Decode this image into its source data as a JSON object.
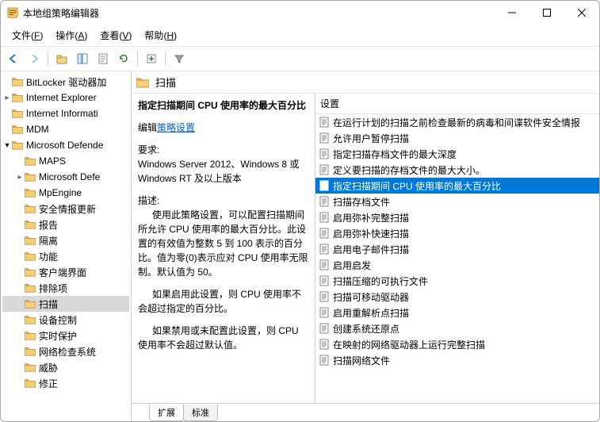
{
  "window": {
    "title": "本地组策略编辑器"
  },
  "menu": {
    "file": {
      "label": "文件",
      "accel": "F"
    },
    "action": {
      "label": "操作",
      "accel": "A"
    },
    "view": {
      "label": "查看",
      "accel": "V"
    },
    "help": {
      "label": "帮助",
      "accel": "H"
    }
  },
  "tree": {
    "items": [
      {
        "label": "BitLocker 驱动器加",
        "depth": 0,
        "chev": ""
      },
      {
        "label": "Internet Explorer",
        "depth": 0,
        "chev": "closed"
      },
      {
        "label": "Internet Informati",
        "depth": 0,
        "chev": ""
      },
      {
        "label": "MDM",
        "depth": 0,
        "chev": ""
      },
      {
        "label": "Microsoft Defende",
        "depth": 0,
        "chev": "open"
      },
      {
        "label": "MAPS",
        "depth": 1,
        "chev": ""
      },
      {
        "label": "Microsoft Defe",
        "depth": 1,
        "chev": "closed"
      },
      {
        "label": "MpEngine",
        "depth": 1,
        "chev": ""
      },
      {
        "label": "安全情报更新",
        "depth": 1,
        "chev": ""
      },
      {
        "label": "报告",
        "depth": 1,
        "chev": ""
      },
      {
        "label": "隔离",
        "depth": 1,
        "chev": ""
      },
      {
        "label": "功能",
        "depth": 1,
        "chev": ""
      },
      {
        "label": "客户端界面",
        "depth": 1,
        "chev": ""
      },
      {
        "label": "排除项",
        "depth": 1,
        "chev": ""
      },
      {
        "label": "扫描",
        "depth": 1,
        "chev": "",
        "selected": true
      },
      {
        "label": "设备控制",
        "depth": 1,
        "chev": ""
      },
      {
        "label": "实时保护",
        "depth": 1,
        "chev": ""
      },
      {
        "label": "网络检查系统",
        "depth": 1,
        "chev": ""
      },
      {
        "label": "威胁",
        "depth": 1,
        "chev": ""
      },
      {
        "label": "修正",
        "depth": 1,
        "chev": ""
      }
    ]
  },
  "pathHeader": "扫描",
  "desc": {
    "title": "指定扫描期间 CPU 使用率的最大百分比",
    "editPrefix": "编辑",
    "editLink": "策略设置",
    "reqLabel": "要求:",
    "reqText": "Windows Server 2012、Windows 8 或 Windows RT 及以上版本",
    "descLabel": "描述:",
    "p1": "使用此策略设置，可以配置扫描期间所允许 CPU 使用率的最大百分比。此设置的有效值为整数 5 到 100 表示的百分比。值为零(0)表示应对 CPU 使用率无限制。默认值为 50。",
    "p2": "如果启用此设置，则 CPU 使用率不会超过指定的百分比。",
    "p3": "如果禁用或未配置此设置，则 CPU 使用率不会超过默认值。"
  },
  "listHeader": "设置",
  "settings": [
    {
      "label": "在运行计划的扫描之前检查最新的病毒和间谍软件安全情报"
    },
    {
      "label": "允许用户暂停扫描"
    },
    {
      "label": "指定扫描存档文件的最大深度"
    },
    {
      "label": "定义要扫描的存档文件的最大大小。"
    },
    {
      "label": "指定扫描期间 CPU 使用率的最大百分比",
      "selected": true
    },
    {
      "label": "扫描存档文件"
    },
    {
      "label": "启用弥补完整扫描"
    },
    {
      "label": "启用弥补快速扫描"
    },
    {
      "label": "启用电子邮件扫描"
    },
    {
      "label": "启用启发"
    },
    {
      "label": "扫描压缩的可执行文件"
    },
    {
      "label": "扫描可移动驱动器"
    },
    {
      "label": "启用重解析点扫描"
    },
    {
      "label": "创建系统还原点"
    },
    {
      "label": "在映射的网络驱动器上运行完整扫描"
    },
    {
      "label": "扫描网络文件"
    }
  ],
  "tabs": {
    "extended": "扩展",
    "standard": "标准"
  }
}
